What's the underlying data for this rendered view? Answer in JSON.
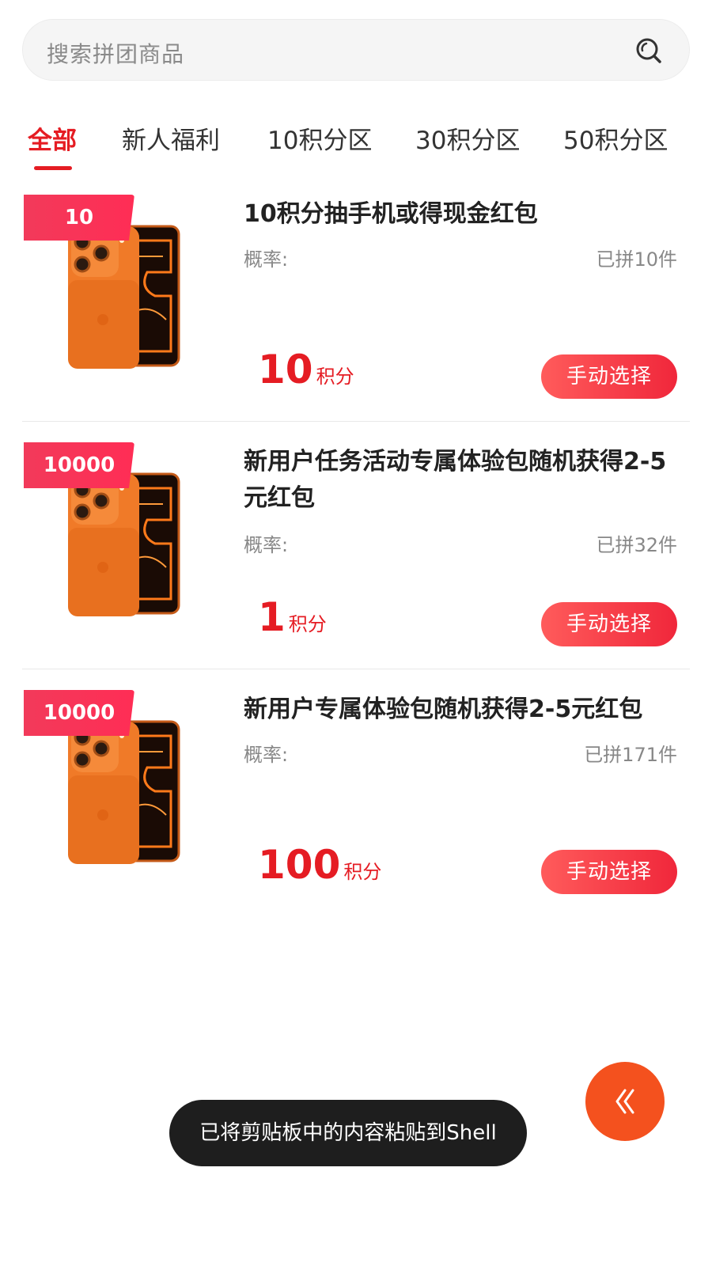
{
  "search": {
    "placeholder": "搜索拼团商品"
  },
  "tabs": [
    {
      "label": "全部",
      "active": true
    },
    {
      "label": "新人福利"
    },
    {
      "label": "10积分区"
    },
    {
      "label": "30积分区"
    },
    {
      "label": "50积分区"
    }
  ],
  "products": [
    {
      "badge": "10",
      "title": "10积分抽手机或得现金红包",
      "probability_label": "概率:",
      "sold": "已拼10件",
      "price": "10",
      "price_unit": "积分",
      "button": "手动选择"
    },
    {
      "badge": "10000",
      "title": "新用户任务活动专属体验包随机获得2-5元红包",
      "probability_label": "概率:",
      "sold": "已拼32件",
      "price": "1",
      "price_unit": "积分",
      "button": "手动选择"
    },
    {
      "badge": "10000",
      "title": "新用户专属体验包随机获得2-5元红包",
      "probability_label": "概率:",
      "sold": "已拼171件",
      "price": "100",
      "price_unit": "积分",
      "button": "手动选择"
    }
  ],
  "floating_button": {
    "icon": "double-chevron-left-icon"
  },
  "toast": {
    "text": "已将剪贴板中的内容粘贴到Shell"
  },
  "colors": {
    "accent": "#e51c23",
    "phone_orange": "#f07a28",
    "float_button": "#f4511e"
  }
}
